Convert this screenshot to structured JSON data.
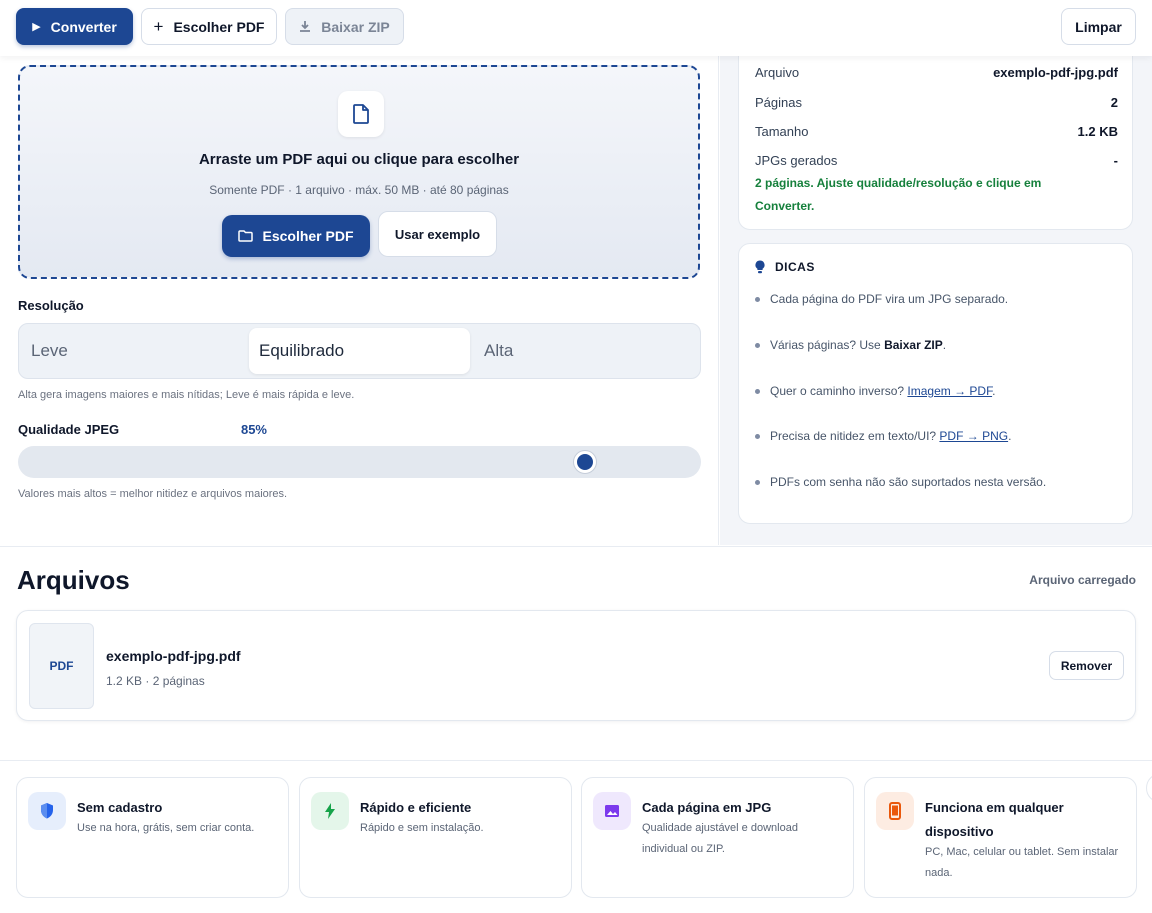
{
  "toolbar": {
    "convert_label": "Converter",
    "choose_label": "Escolher PDF",
    "zip_label": "Baixar ZIP",
    "clear_label": "Limpar"
  },
  "dropzone": {
    "title": "Arraste um PDF aqui ou clique para escolher",
    "subtitle": "Somente PDF · 1 arquivo · máx. 50 MB · até 80 páginas",
    "choose_label": "Escolher PDF",
    "example_label": "Usar exemplo"
  },
  "resolution": {
    "label": "Resolução",
    "options": [
      "Leve",
      "Equilibrado",
      "Alta"
    ],
    "selected": "Equilibrado",
    "hint": "Alta gera imagens maiores e mais nítidas; Leve é mais rápida e leve."
  },
  "quality": {
    "label": "Qualidade JPEG",
    "value_text": "85%",
    "value": 85,
    "hint": "Valores mais altos = melhor nitidez e arquivos maiores."
  },
  "info": {
    "rows": [
      {
        "key": "Arquivo",
        "value": "exemplo-pdf-jpg.pdf"
      },
      {
        "key": "Páginas",
        "value": "2"
      },
      {
        "key": "Tamanho",
        "value": "1.2 KB"
      },
      {
        "key": "JPGs gerados",
        "value": "-"
      }
    ],
    "status": "2 páginas. Ajuste qualidade/resolução e clique em Converter."
  },
  "tips": {
    "title": "DICAS",
    "items": [
      {
        "text": "Cada página do PDF vira um JPG separado."
      },
      {
        "prefix": "Várias páginas? Use ",
        "bold": "Baixar ZIP",
        "suffix": "."
      },
      {
        "prefix": "Quer o caminho inverso? ",
        "link": "Imagem → PDF",
        "suffix": "."
      },
      {
        "prefix": "Precisa de nitidez em texto/UI? ",
        "link": "PDF → PNG",
        "suffix": "."
      },
      {
        "text": "PDFs com senha não são suportados nesta versão."
      }
    ]
  },
  "files": {
    "title": "Arquivos",
    "status": "Arquivo carregado",
    "items": [
      {
        "thumb": "PDF",
        "name": "exemplo-pdf-jpg.pdf",
        "meta": "1.2 KB · 2 páginas",
        "remove_label": "Remover"
      }
    ]
  },
  "features": [
    {
      "icon": "shield-icon",
      "title": "Sem cadastro",
      "text": "Use na hora, grátis, sem criar conta.",
      "color": "#2563eb",
      "bg": "#e6eefc"
    },
    {
      "icon": "bolt-icon",
      "title": "Rápido e eficiente",
      "text": "Rápido e sem instalação.",
      "color": "#16a34a",
      "bg": "#e4f6ea"
    },
    {
      "icon": "image-icon",
      "title": "Cada página em JPG",
      "text": "Qualidade ajustável e download individual ou ZIP.",
      "color": "#7c3aed",
      "bg": "#efe8fd"
    },
    {
      "icon": "phone-icon",
      "title": "Funciona em qualquer dispositivo",
      "text": "PC, Mac, celular ou tablet. Sem instalar nada.",
      "color": "#ea580c",
      "bg": "#fdece2"
    }
  ],
  "colors": {
    "primary": "#1d4793",
    "success": "#16803c"
  }
}
